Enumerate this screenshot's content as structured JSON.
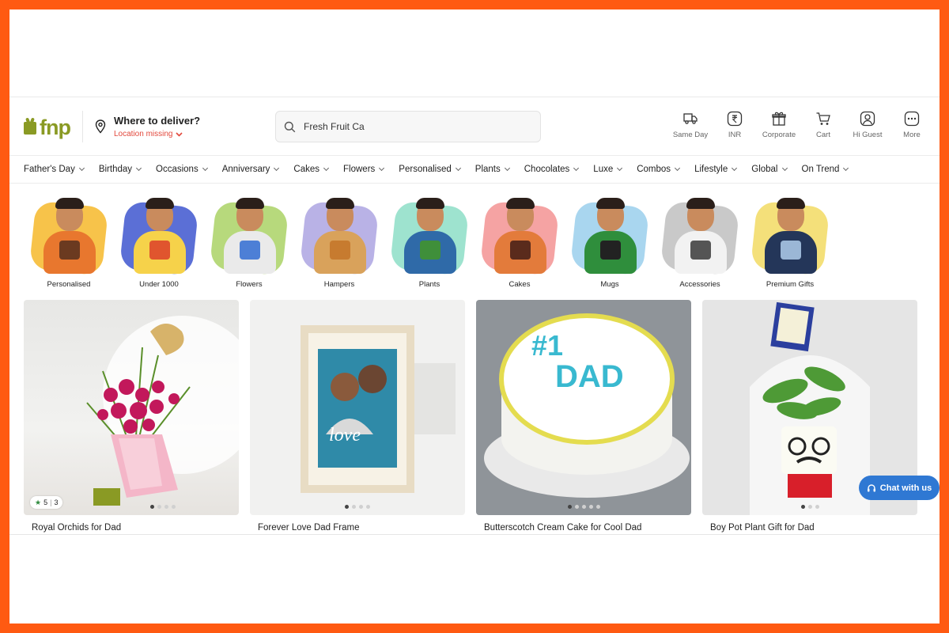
{
  "header": {
    "logo_text": "fnp",
    "location": {
      "title": "Where to deliver?",
      "status": "Location missing"
    },
    "search": {
      "value": "Fresh Fruit Ca"
    },
    "actions": [
      {
        "label": "Same Day",
        "icon": "truck-icon"
      },
      {
        "label": "INR",
        "icon": "rupee-icon"
      },
      {
        "label": "Corporate",
        "icon": "gift-icon"
      },
      {
        "label": "Cart",
        "icon": "cart-icon"
      },
      {
        "label": "Hi Guest",
        "icon": "user-icon"
      },
      {
        "label": "More",
        "icon": "more-icon"
      }
    ]
  },
  "nav": {
    "items": [
      "Father's Day",
      "Birthday",
      "Occasions",
      "Anniversary",
      "Cakes",
      "Flowers",
      "Personalised",
      "Plants",
      "Chocolates",
      "Luxe",
      "Combos",
      "Lifestyle",
      "Global",
      "On Trend"
    ]
  },
  "categories": [
    {
      "label": "Personalised",
      "bg": "#f7c34a",
      "shirt": "#e8772e",
      "prop": "#6b3a20"
    },
    {
      "label": "Under 1000",
      "bg": "#5b6fd6",
      "shirt": "#f6d24a",
      "prop": "#e0552e"
    },
    {
      "label": "Flowers",
      "bg": "#b7d97c",
      "shirt": "#eaeaea",
      "prop": "#4d7fd6"
    },
    {
      "label": "Hampers",
      "bg": "#b9b2e6",
      "shirt": "#d9a25b",
      "prop": "#c77b2f"
    },
    {
      "label": "Plants",
      "bg": "#9ee3cf",
      "shirt": "#2f6aa8",
      "prop": "#3f8f3a"
    },
    {
      "label": "Cakes",
      "bg": "#f5a3a3",
      "shirt": "#e37b3b",
      "prop": "#5a2b1c"
    },
    {
      "label": "Mugs",
      "bg": "#a9d6ef",
      "shirt": "#2f8e3c",
      "prop": "#222222"
    },
    {
      "label": "Accessories",
      "bg": "#c9c9c9",
      "shirt": "#f2f2f2",
      "prop": "#555555"
    },
    {
      "label": "Premium Gifts",
      "bg": "#f4e07a",
      "shirt": "#243659",
      "prop": "#9bb7d6"
    }
  ],
  "products": [
    {
      "title": "Royal Orchids for Dad",
      "rating": "5",
      "reviews": "3",
      "dots": 4,
      "active_dot": 0
    },
    {
      "title": "Forever Love Dad Frame",
      "dots": 4,
      "active_dot": 0
    },
    {
      "title": "Butterscotch Cream Cake for Cool Dad",
      "dots": 5,
      "active_dot": 0
    },
    {
      "title": "Boy Pot Plant Gift for Dad",
      "dots": 3,
      "active_dot": 0
    }
  ],
  "chat": {
    "label": "Chat with us"
  },
  "colors": {
    "accent": "#8a9a24",
    "border": "#ff5a12",
    "chat": "#2f78d3",
    "alert": "#e2483c"
  }
}
